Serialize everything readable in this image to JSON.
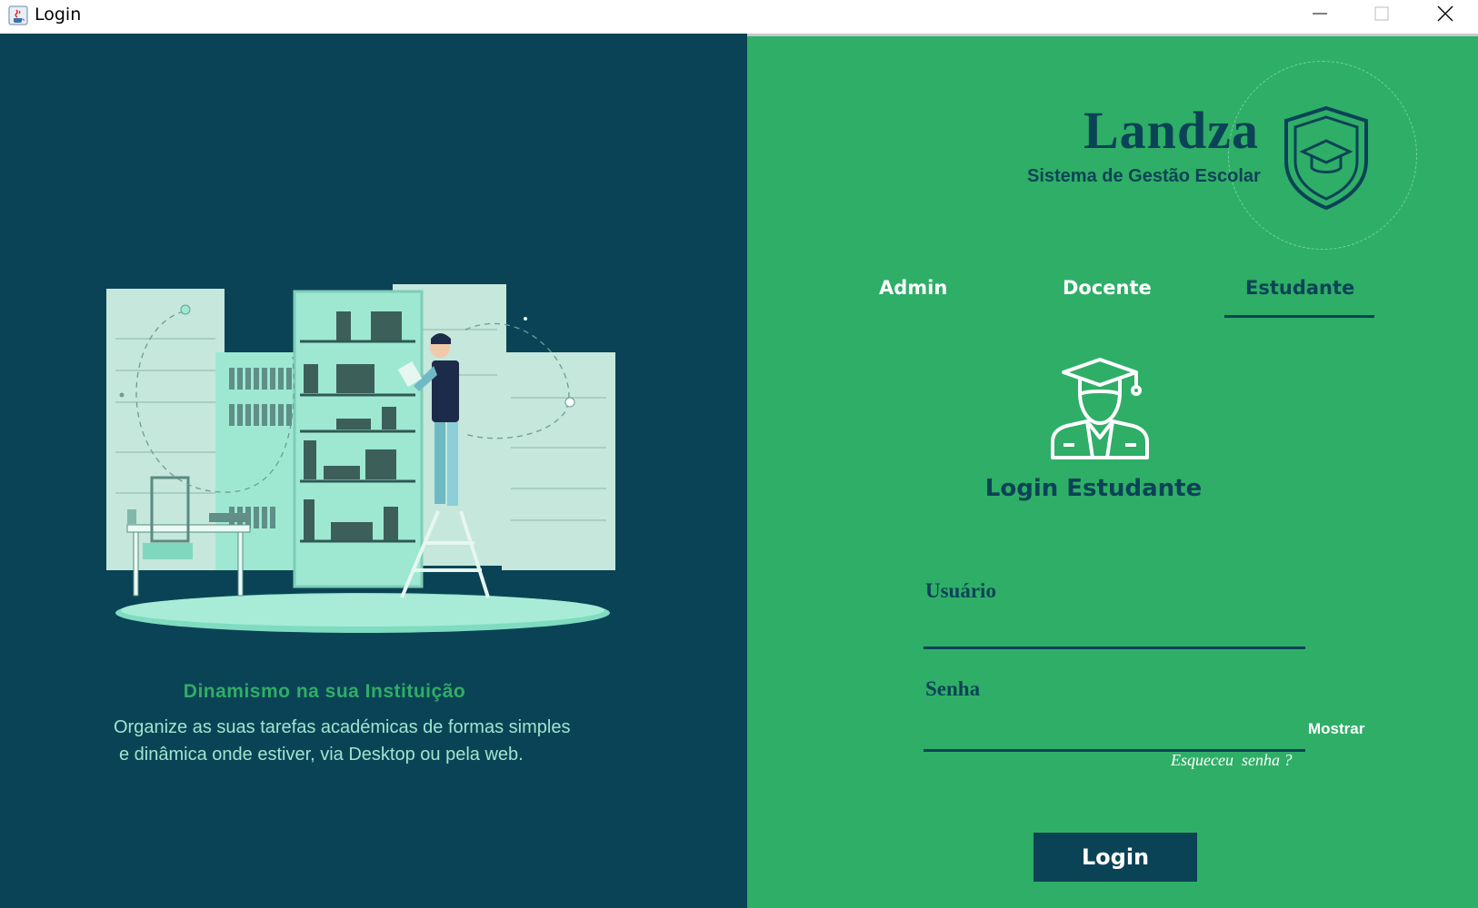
{
  "window": {
    "title": "Login",
    "icon": "java-coffee-icon",
    "controls": [
      "minimize-icon",
      "maximize-icon",
      "close-icon"
    ]
  },
  "left": {
    "heading": "Dinamismo na sua Instituição",
    "description_line1": "Organize as suas tarefas académicas de formas simples",
    "description_line2": "e dinâmica onde estiver, via Desktop ou pela web.",
    "illustration": "library-bookshelf-illustration"
  },
  "brand": {
    "name": "Landza",
    "subtitle": "Sistema de Gestão Escolar",
    "logo_icon": "shield-graduation-cap-icon"
  },
  "tabs": [
    {
      "label": "Admin",
      "active": false
    },
    {
      "label": "Docente",
      "active": false
    },
    {
      "label": "Estudante",
      "active": true
    }
  ],
  "login": {
    "title": "Login Estudante",
    "avatar_icon": "student-graduate-icon",
    "username_label": "Usuário",
    "username_value": "",
    "password_label": "Senha",
    "password_value": "",
    "show_password": "Mostrar",
    "forgot_password": "Esqueceu  senha ?",
    "button": "Login"
  },
  "colors": {
    "dark": "#0b4356",
    "green": "#2fae67",
    "mint": "#9ee5cd",
    "white": "#ffffff"
  }
}
